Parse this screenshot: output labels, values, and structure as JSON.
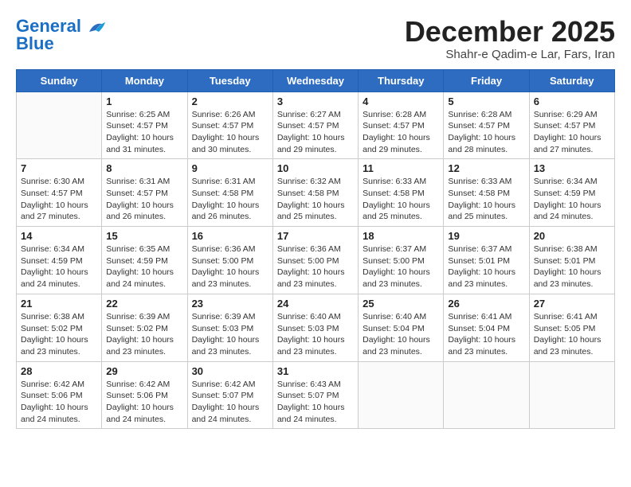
{
  "header": {
    "logo_line1": "General",
    "logo_line2": "Blue",
    "month": "December 2025",
    "location": "Shahr-e Qadim-e Lar, Fars, Iran"
  },
  "weekdays": [
    "Sunday",
    "Monday",
    "Tuesday",
    "Wednesday",
    "Thursday",
    "Friday",
    "Saturday"
  ],
  "weeks": [
    [
      {
        "day": "",
        "info": ""
      },
      {
        "day": "1",
        "info": "Sunrise: 6:25 AM\nSunset: 4:57 PM\nDaylight: 10 hours\nand 31 minutes."
      },
      {
        "day": "2",
        "info": "Sunrise: 6:26 AM\nSunset: 4:57 PM\nDaylight: 10 hours\nand 30 minutes."
      },
      {
        "day": "3",
        "info": "Sunrise: 6:27 AM\nSunset: 4:57 PM\nDaylight: 10 hours\nand 29 minutes."
      },
      {
        "day": "4",
        "info": "Sunrise: 6:28 AM\nSunset: 4:57 PM\nDaylight: 10 hours\nand 29 minutes."
      },
      {
        "day": "5",
        "info": "Sunrise: 6:28 AM\nSunset: 4:57 PM\nDaylight: 10 hours\nand 28 minutes."
      },
      {
        "day": "6",
        "info": "Sunrise: 6:29 AM\nSunset: 4:57 PM\nDaylight: 10 hours\nand 27 minutes."
      }
    ],
    [
      {
        "day": "7",
        "info": "Sunrise: 6:30 AM\nSunset: 4:57 PM\nDaylight: 10 hours\nand 27 minutes."
      },
      {
        "day": "8",
        "info": "Sunrise: 6:31 AM\nSunset: 4:57 PM\nDaylight: 10 hours\nand 26 minutes."
      },
      {
        "day": "9",
        "info": "Sunrise: 6:31 AM\nSunset: 4:58 PM\nDaylight: 10 hours\nand 26 minutes."
      },
      {
        "day": "10",
        "info": "Sunrise: 6:32 AM\nSunset: 4:58 PM\nDaylight: 10 hours\nand 25 minutes."
      },
      {
        "day": "11",
        "info": "Sunrise: 6:33 AM\nSunset: 4:58 PM\nDaylight: 10 hours\nand 25 minutes."
      },
      {
        "day": "12",
        "info": "Sunrise: 6:33 AM\nSunset: 4:58 PM\nDaylight: 10 hours\nand 25 minutes."
      },
      {
        "day": "13",
        "info": "Sunrise: 6:34 AM\nSunset: 4:59 PM\nDaylight: 10 hours\nand 24 minutes."
      }
    ],
    [
      {
        "day": "14",
        "info": "Sunrise: 6:34 AM\nSunset: 4:59 PM\nDaylight: 10 hours\nand 24 minutes."
      },
      {
        "day": "15",
        "info": "Sunrise: 6:35 AM\nSunset: 4:59 PM\nDaylight: 10 hours\nand 24 minutes."
      },
      {
        "day": "16",
        "info": "Sunrise: 6:36 AM\nSunset: 5:00 PM\nDaylight: 10 hours\nand 23 minutes."
      },
      {
        "day": "17",
        "info": "Sunrise: 6:36 AM\nSunset: 5:00 PM\nDaylight: 10 hours\nand 23 minutes."
      },
      {
        "day": "18",
        "info": "Sunrise: 6:37 AM\nSunset: 5:00 PM\nDaylight: 10 hours\nand 23 minutes."
      },
      {
        "day": "19",
        "info": "Sunrise: 6:37 AM\nSunset: 5:01 PM\nDaylight: 10 hours\nand 23 minutes."
      },
      {
        "day": "20",
        "info": "Sunrise: 6:38 AM\nSunset: 5:01 PM\nDaylight: 10 hours\nand 23 minutes."
      }
    ],
    [
      {
        "day": "21",
        "info": "Sunrise: 6:38 AM\nSunset: 5:02 PM\nDaylight: 10 hours\nand 23 minutes."
      },
      {
        "day": "22",
        "info": "Sunrise: 6:39 AM\nSunset: 5:02 PM\nDaylight: 10 hours\nand 23 minutes."
      },
      {
        "day": "23",
        "info": "Sunrise: 6:39 AM\nSunset: 5:03 PM\nDaylight: 10 hours\nand 23 minutes."
      },
      {
        "day": "24",
        "info": "Sunrise: 6:40 AM\nSunset: 5:03 PM\nDaylight: 10 hours\nand 23 minutes."
      },
      {
        "day": "25",
        "info": "Sunrise: 6:40 AM\nSunset: 5:04 PM\nDaylight: 10 hours\nand 23 minutes."
      },
      {
        "day": "26",
        "info": "Sunrise: 6:41 AM\nSunset: 5:04 PM\nDaylight: 10 hours\nand 23 minutes."
      },
      {
        "day": "27",
        "info": "Sunrise: 6:41 AM\nSunset: 5:05 PM\nDaylight: 10 hours\nand 23 minutes."
      }
    ],
    [
      {
        "day": "28",
        "info": "Sunrise: 6:42 AM\nSunset: 5:06 PM\nDaylight: 10 hours\nand 24 minutes."
      },
      {
        "day": "29",
        "info": "Sunrise: 6:42 AM\nSunset: 5:06 PM\nDaylight: 10 hours\nand 24 minutes."
      },
      {
        "day": "30",
        "info": "Sunrise: 6:42 AM\nSunset: 5:07 PM\nDaylight: 10 hours\nand 24 minutes."
      },
      {
        "day": "31",
        "info": "Sunrise: 6:43 AM\nSunset: 5:07 PM\nDaylight: 10 hours\nand 24 minutes."
      },
      {
        "day": "",
        "info": ""
      },
      {
        "day": "",
        "info": ""
      },
      {
        "day": "",
        "info": ""
      }
    ]
  ]
}
